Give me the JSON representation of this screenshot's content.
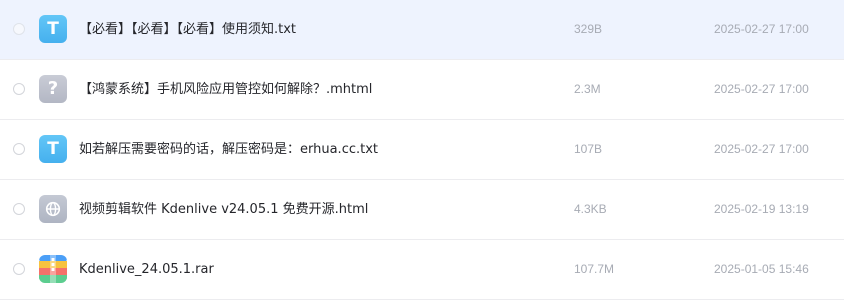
{
  "files": [
    {
      "name": "【必看】【必看】【必看】使用须知.txt",
      "size": "329B",
      "date": "2025-02-27 17:00",
      "icon": "txt-file-icon",
      "icon_glyph": "T"
    },
    {
      "name": "【鸿蒙系统】手机风险应用管控如何解除？.mhtml",
      "size": "2.3M",
      "date": "2025-02-27 17:00",
      "icon": "unknown-file-icon",
      "icon_glyph": "?"
    },
    {
      "name": "如若解压需要密码的话，解压密码是：erhua.cc.txt",
      "size": "107B",
      "date": "2025-02-27 17:00",
      "icon": "txt-file-icon",
      "icon_glyph": "T"
    },
    {
      "name": "视频剪辑软件 Kdenlive v24.05.1 免费开源.html",
      "size": "4.3KB",
      "date": "2025-02-19 13:19",
      "icon": "html-file-icon"
    },
    {
      "name": "Kdenlive_24.05.1.rar",
      "size": "107.7M",
      "date": "2025-01-05 15:46",
      "icon": "rar-archive-icon"
    }
  ],
  "colors": {
    "row_highlight": "#eef3fe",
    "txt_icon": "#4fb8f2",
    "meta_text": "#a7abb4",
    "name_text": "#25262b"
  }
}
